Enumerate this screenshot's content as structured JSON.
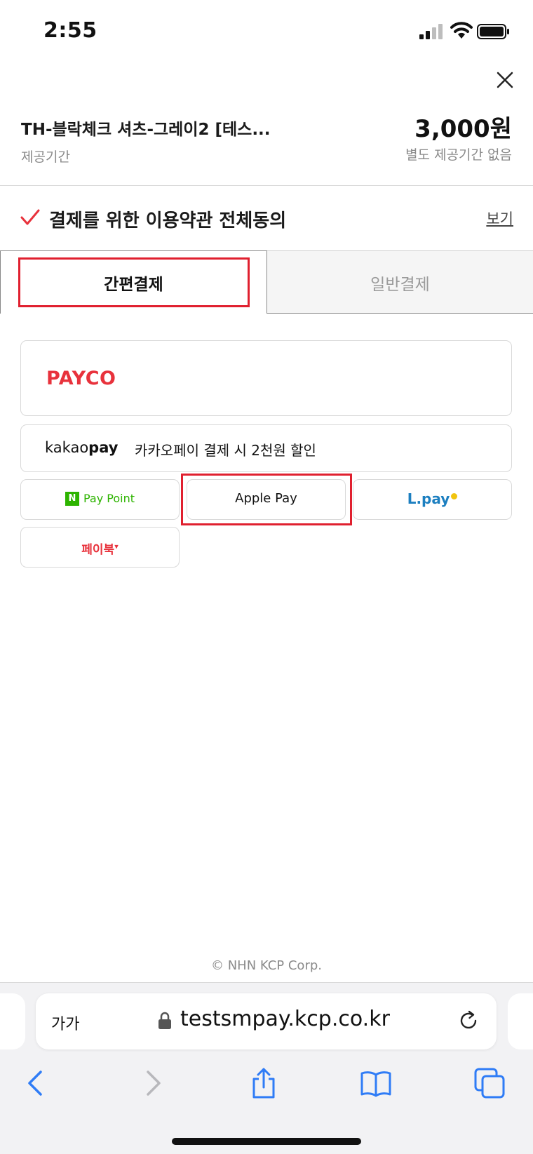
{
  "status_bar": {
    "time": "2:55"
  },
  "product": {
    "name": "TH-블락체크 셔츠-그레이2 [테스...",
    "period_label": "제공기간",
    "price": "3,000원",
    "period_value": "별도 제공기간 없음"
  },
  "agreement": {
    "text": "결제를 위한 이용약관 전체동의",
    "view_link": "보기"
  },
  "tabs": {
    "easy": "간편결제",
    "normal": "일반결제"
  },
  "payments": {
    "payco": "PAYCO",
    "kakao_logo_prefix": "kakao",
    "kakao_logo_suffix": "pay",
    "kakao_promo": "카카오페이 결제 시 2천원 할인",
    "naver_badge": "N",
    "naver_label": "Pay Point",
    "apple_pay": "Apple Pay",
    "lpay": "L.pay",
    "paybook": "페이북"
  },
  "footer": {
    "copyright": "© NHN KCP Corp."
  },
  "browser": {
    "aa": "가가",
    "url": "testsmpay.kcp.co.kr"
  },
  "colors": {
    "accent_red": "#e0202f",
    "payco_red": "#e8323c",
    "naver_green": "#2db400",
    "lpay_blue": "#1c7fc0",
    "ios_blue": "#2f7cf6"
  }
}
